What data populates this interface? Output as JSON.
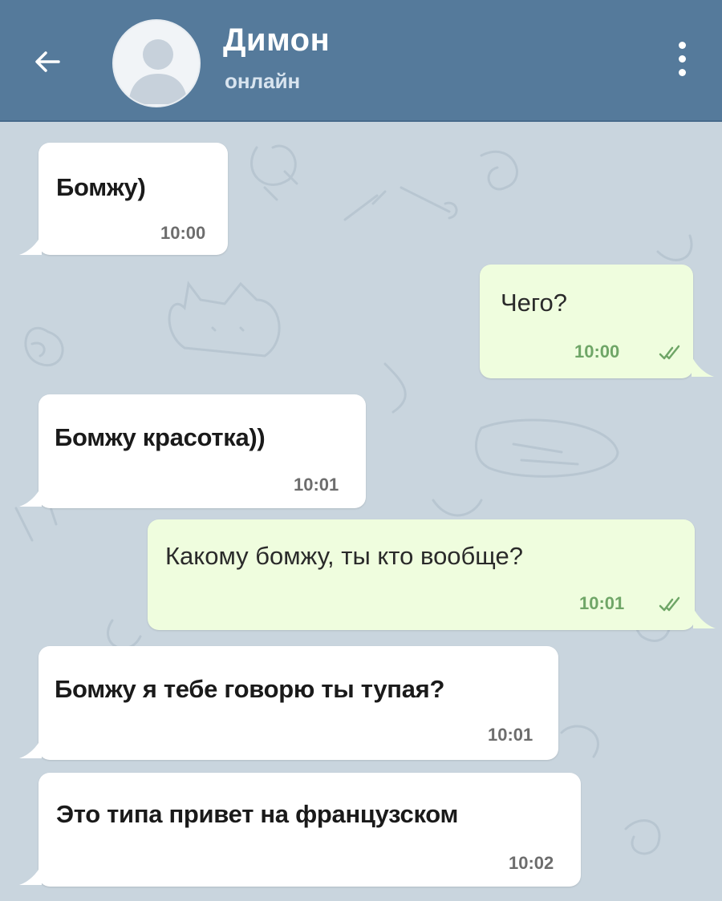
{
  "header": {
    "back_icon": "arrow-left-icon",
    "avatar_icon": "default-user-avatar",
    "name": "Димон",
    "status": "онлайн",
    "menu_icon": "more-vertical-icon"
  },
  "messages": [
    {
      "direction": "in",
      "text": "Бомжу)",
      "time": "10:00"
    },
    {
      "direction": "out",
      "text": "Чего?",
      "time": "10:00",
      "status_icon": "double-check-icon"
    },
    {
      "direction": "in",
      "text": "Бомжу красотка))",
      "time": "10:01"
    },
    {
      "direction": "out",
      "text": "Какому бомжу, ты кто вообще?",
      "time": "10:01",
      "status_icon": "double-check-icon"
    },
    {
      "direction": "in",
      "text": "Бомжу я тебе говорю ты тупая?",
      "time": "10:01"
    },
    {
      "direction": "in",
      "text": "Это типа привет на французском",
      "time": "10:02"
    }
  ],
  "colors": {
    "header": "#557a9b",
    "chat_background": "#c9d5de",
    "incoming_bubble": "#ffffff",
    "outgoing_bubble": "#effdde",
    "read_check": "#6fa667"
  }
}
